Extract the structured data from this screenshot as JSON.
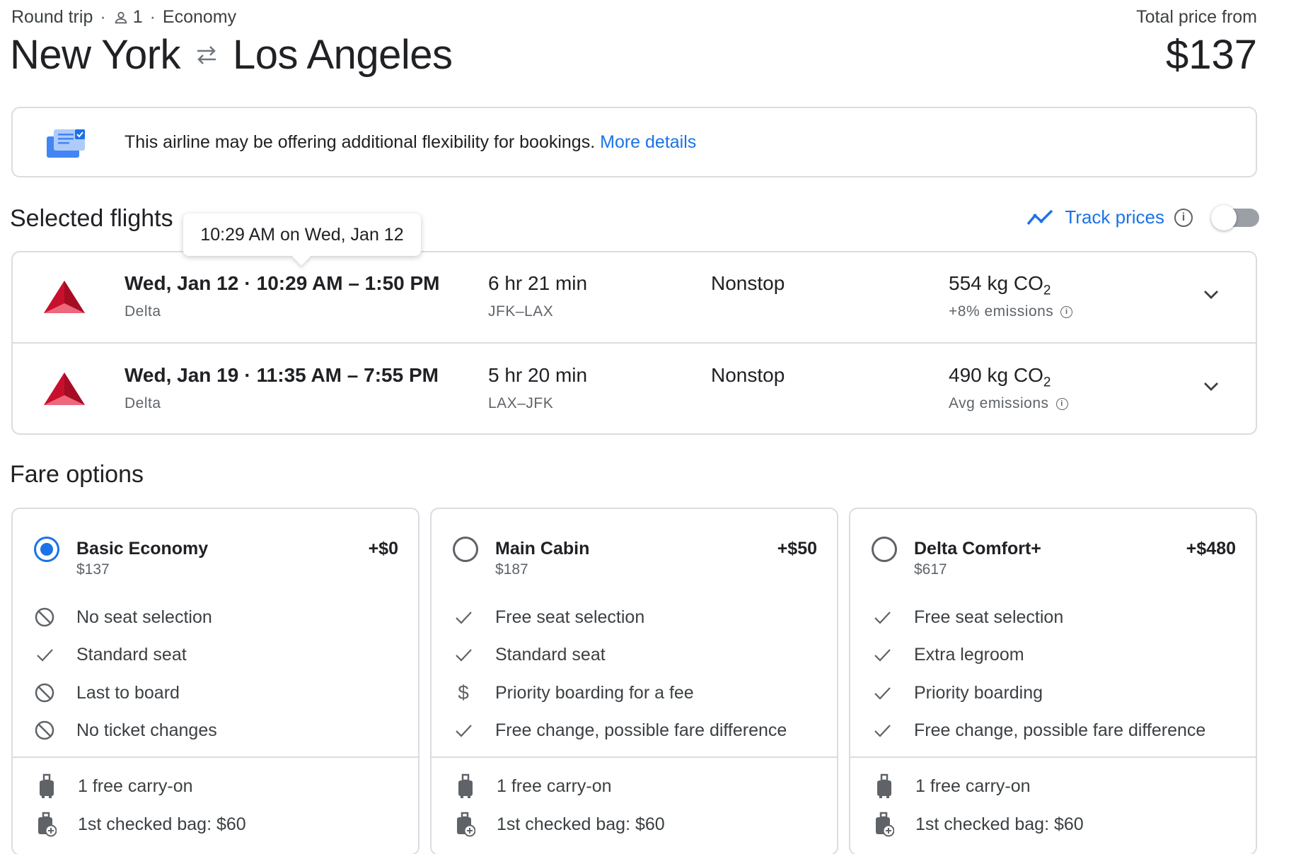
{
  "header": {
    "trip_type": "Round trip",
    "dot": "·",
    "passengers": "1",
    "cabin": "Economy",
    "origin": "New York",
    "destination": "Los Angeles",
    "price_label": "Total price from",
    "price": "$137"
  },
  "banner": {
    "text": "This airline may be offering additional flexibility for bookings.",
    "link": "More details"
  },
  "selected_flights": {
    "title": "Selected flights",
    "track_label": "Track prices",
    "track_enabled": false,
    "tooltip": "10:29 AM on Wed, Jan 12",
    "flights": [
      {
        "date": "Wed, Jan 12",
        "times": "10:29 AM – 1:50 PM",
        "airline": "Delta",
        "duration": "6 hr 21 min",
        "route": "JFK–LAX",
        "stops": "Nonstop",
        "co2": "554 kg CO",
        "co2_sub": "2",
        "emissions": "+8% emissions"
      },
      {
        "date": "Wed, Jan 19",
        "times": "11:35 AM – 7:55 PM",
        "airline": "Delta",
        "duration": "5 hr 20 min",
        "route": "LAX–JFK",
        "stops": "Nonstop",
        "co2": "490 kg CO",
        "co2_sub": "2",
        "emissions": "Avg emissions"
      }
    ]
  },
  "fare_options": {
    "title": "Fare options",
    "fares": [
      {
        "name": "Basic Economy",
        "delta": "+$0",
        "base": "$137",
        "selected": true,
        "features": [
          {
            "icon": "block-icon",
            "text": "No seat selection"
          },
          {
            "icon": "check-icon",
            "text": "Standard seat"
          },
          {
            "icon": "block-icon",
            "text": "Last to board"
          },
          {
            "icon": "block-icon",
            "text": "No ticket changes"
          }
        ],
        "carry_on": "1 free carry-on",
        "checked": "1st checked bag: $60"
      },
      {
        "name": "Main Cabin",
        "delta": "+$50",
        "base": "$187",
        "selected": false,
        "features": [
          {
            "icon": "check-icon",
            "text": "Free seat selection"
          },
          {
            "icon": "check-icon",
            "text": "Standard seat"
          },
          {
            "icon": "dollar-icon",
            "text": "Priority boarding for a fee"
          },
          {
            "icon": "check-icon",
            "text": "Free change, possible fare difference"
          }
        ],
        "carry_on": "1 free carry-on",
        "checked": "1st checked bag: $60"
      },
      {
        "name": "Delta Comfort+",
        "delta": "+$480",
        "base": "$617",
        "selected": false,
        "features": [
          {
            "icon": "check-icon",
            "text": "Free seat selection"
          },
          {
            "icon": "check-icon",
            "text": "Extra legroom"
          },
          {
            "icon": "check-icon",
            "text": "Priority boarding"
          },
          {
            "icon": "check-icon",
            "text": "Free change, possible fare difference"
          }
        ],
        "carry_on": "1 free carry-on",
        "checked": "1st checked bag: $60"
      }
    ]
  },
  "colors": {
    "accent": "#1a73e8",
    "delta_red": "#c8102e",
    "border": "#dadce0",
    "muted": "#5f6368"
  }
}
